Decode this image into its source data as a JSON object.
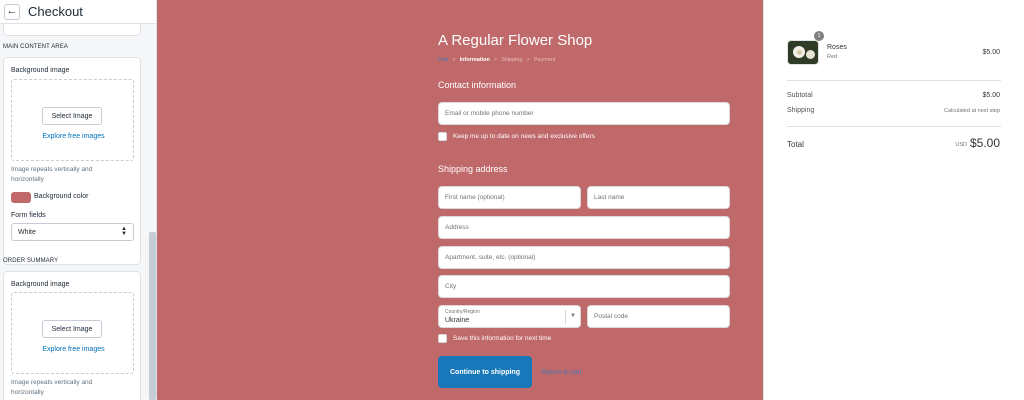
{
  "sidebar": {
    "title": "Checkout",
    "main_content": {
      "heading": "MAIN CONTENT AREA",
      "background_image_label": "Background image",
      "select_image_label": "Select Image",
      "explore_label": "Explore free images",
      "hint": "Image repeats vertically and horizontally",
      "background_color_label": "Background color",
      "background_color": "#c0696a",
      "form_fields_label": "Form fields",
      "form_fields_value": "White"
    },
    "order_summary": {
      "heading": "ORDER SUMMARY",
      "background_image_label": "Background image",
      "select_image_label": "Select Image",
      "explore_label": "Explore free images",
      "hint": "Image repeats vertically and horizontally"
    }
  },
  "preview": {
    "shop_name": "A Regular Flower Shop",
    "breadcrumb": {
      "cart": "Cart",
      "information": "Information",
      "shipping": "Shipping",
      "payment": "Payment",
      "separator": ">"
    },
    "contact": {
      "title": "Contact information",
      "email_placeholder": "Email or mobile phone number",
      "newsletter_label": "Keep me up to date on news and exclusive offers"
    },
    "shipping": {
      "title": "Shipping address",
      "first_name_placeholder": "First name (optional)",
      "last_name_placeholder": "Last name",
      "address_placeholder": "Address",
      "apartment_placeholder": "Apartment, suite, etc. (optional)",
      "city_placeholder": "City",
      "country_label": "Country/Region",
      "country_value": "Ukraine",
      "postal_placeholder": "Postal code",
      "save_label": "Save this information for next time"
    },
    "continue_label": "Continue to shipping",
    "return_label": "Return to cart"
  },
  "summary": {
    "item": {
      "name": "Roses",
      "variant": "Red",
      "price": "$5.00",
      "quantity": "1"
    },
    "subtotal_label": "Subtotal",
    "subtotal_value": "$5.00",
    "shipping_label": "Shipping",
    "shipping_value": "Calculated at next step",
    "total_label": "Total",
    "currency": "USD",
    "total_value": "$5.00"
  },
  "colors": {
    "main_background": "#c0696a",
    "button": "#1878b9",
    "link": "#3e78bd"
  },
  "icons": {
    "back": "arrow-left-icon",
    "select_caret": "chevron-updown-icon",
    "country_caret": "chevron-down-icon"
  }
}
